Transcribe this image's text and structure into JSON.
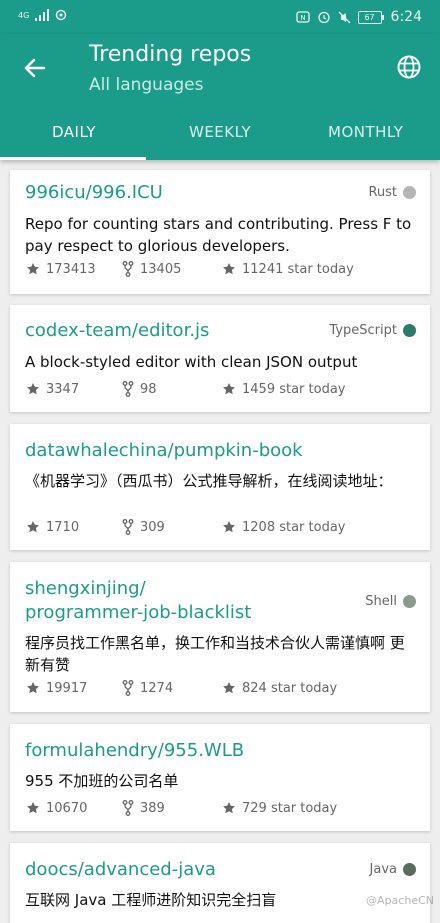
{
  "status_bar": {
    "time": "6:24",
    "battery": "67"
  },
  "app_bar": {
    "title": "Trending repos",
    "subtitle": "All languages"
  },
  "tabs": [
    {
      "label": "DAILY",
      "active": true
    },
    {
      "label": "WEEKLY",
      "active": false
    },
    {
      "label": "MONTHLY",
      "active": false
    }
  ],
  "repos": [
    {
      "name": "996icu/996.ICU",
      "language": "Rust",
      "language_color": "#b5b5b5",
      "description": "Repo for counting stars and contributing. Press F to pay respect to glorious developers.",
      "stars": "173413",
      "forks": "13405",
      "today": "11241 star today"
    },
    {
      "name": "codex-team/editor.js",
      "language": "TypeScript",
      "language_color": "#2b7a6d",
      "description": "A block-styled editor with clean JSON output",
      "stars": "3347",
      "forks": "98",
      "today": "1459 star today"
    },
    {
      "name": "datawhalechina/pumpkin-book",
      "language": "",
      "language_color": "",
      "description": "《机器学习》（西瓜书）公式推导解析，在线阅读地址：",
      "stars": "1710",
      "forks": "309",
      "today": "1208 star today"
    },
    {
      "name_line1": "shengxinjing/",
      "name_line2": "programmer-job-blacklist",
      "language": "Shell",
      "language_color": "#8a9a8f",
      "description": "程序员找工作黑名单，换工作和当技术合伙人需谨慎啊 更新有赞",
      "stars": "19917",
      "forks": "1274",
      "today": "824 star today"
    },
    {
      "name": "formulahendry/955.WLB",
      "language": "",
      "language_color": "",
      "description": "955 不加班的公司名单",
      "stars": "10670",
      "forks": "389",
      "today": "729 star today"
    },
    {
      "name": "doocs/advanced-java",
      "language": "Java",
      "language_color": "#5a6b5f",
      "description": "互联网 Java 工程师进阶知识完全扫盲"
    }
  ],
  "watermark": "@ApacheCN"
}
